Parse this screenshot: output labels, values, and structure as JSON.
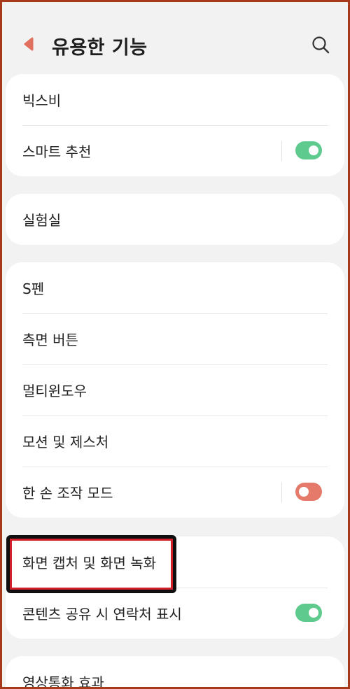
{
  "header": {
    "title": "유용한 기능",
    "back_icon": "back-arrow-icon",
    "search_icon": "search-icon"
  },
  "groups": [
    {
      "items": [
        {
          "label": "빅스비"
        },
        {
          "label": "스마트 추천",
          "toggle": "on"
        }
      ]
    },
    {
      "items": [
        {
          "label": "실험실"
        }
      ]
    },
    {
      "items": [
        {
          "label": "S펜"
        },
        {
          "label": "측면 버튼"
        },
        {
          "label": "멀티윈도우"
        },
        {
          "label": "모션 및 제스처"
        },
        {
          "label": "한 손 조작 모드",
          "toggle": "off"
        }
      ]
    },
    {
      "items": [
        {
          "label": "화면 캡처 및 화면 녹화",
          "highlighted": true
        },
        {
          "label": "콘텐츠 공유 시 연락처 표시",
          "toggle": "on"
        }
      ]
    },
    {
      "items": [
        {
          "label": "영상통화 효과"
        }
      ]
    }
  ],
  "colors": {
    "toggle_on": "#5fca8d",
    "toggle_off": "#e57a6a",
    "highlight_border": "#0f0f0f",
    "highlight_inner": "#d0202a",
    "frame": "#a63a1a"
  }
}
